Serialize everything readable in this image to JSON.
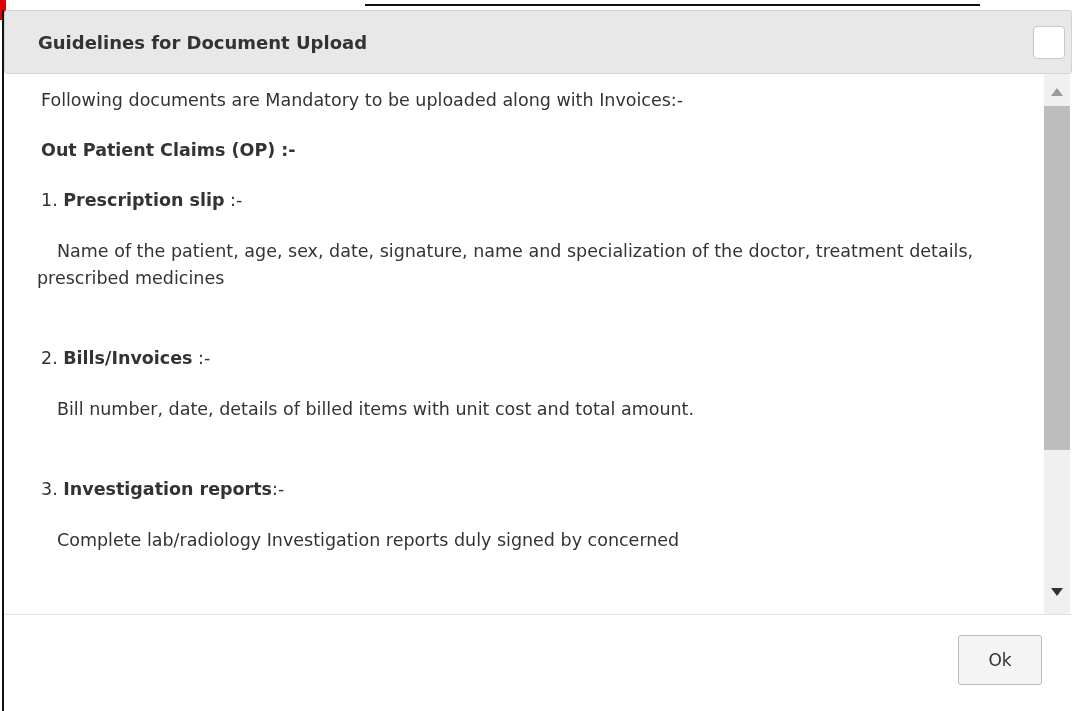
{
  "dialog": {
    "title": "Guidelines for Document Upload",
    "content": [
      {
        "kind": "plain",
        "text": "Following documents are Mandatory to be uploaded along with Invoices:-"
      },
      {
        "kind": "heading",
        "text": "Out Patient Claims (OP) :-"
      },
      {
        "kind": "plain",
        "text": "1. **Prescription slip** :-"
      },
      {
        "kind": "detail",
        "text": "Name of the patient, age, sex, date, signature, name and specialization of the doctor, treatment details, prescribed medicines"
      },
      {
        "kind": "spacer"
      },
      {
        "kind": "plain",
        "text": "2. **Bills/Invoices**  :-"
      },
      {
        "kind": "detail",
        "text": "Bill number, date, details of billed items with unit cost and total amount."
      },
      {
        "kind": "spacer"
      },
      {
        "kind": "plain",
        "text": "3. **Investigation reports**:-"
      },
      {
        "kind": "detail",
        "text": "Complete lab/radiology Investigation reports duly signed by concerned"
      }
    ],
    "buttons": [
      "Ok"
    ]
  }
}
